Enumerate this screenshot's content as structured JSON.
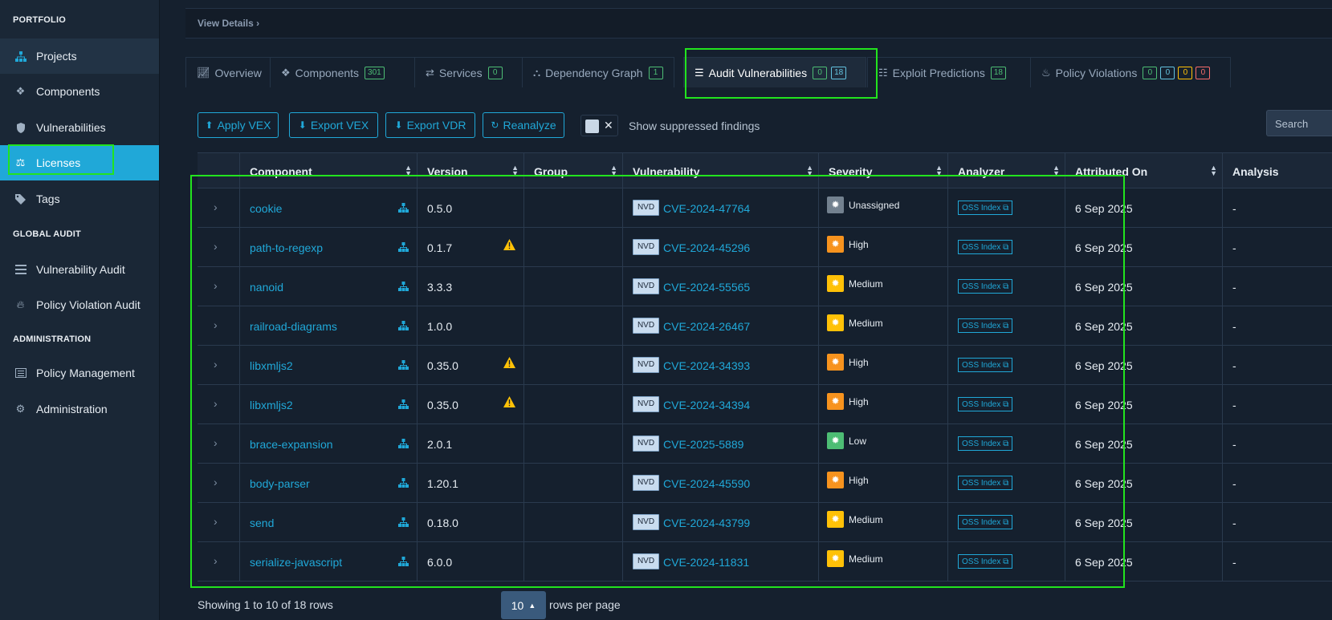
{
  "sidebar": {
    "sections": [
      {
        "label": "PORTFOLIO"
      },
      {
        "label": "GLOBAL AUDIT"
      },
      {
        "label": "ADMINISTRATION"
      }
    ],
    "items": [
      {
        "label": "Projects",
        "icon": "sitemap-icon"
      },
      {
        "label": "Components",
        "icon": "cubes-icon"
      },
      {
        "label": "Vulnerabilities",
        "icon": "shield-icon"
      },
      {
        "label": "Licenses",
        "icon": "balance-scale-icon",
        "active": true
      },
      {
        "label": "Tags",
        "icon": "tag-icon"
      },
      {
        "label": "Vulnerability Audit",
        "icon": "tasks-icon"
      },
      {
        "label": "Policy Violation Audit",
        "icon": "fire-icon"
      },
      {
        "label": "Policy Management",
        "icon": "list-alt-icon"
      },
      {
        "label": "Administration",
        "icon": "cogs-icon"
      }
    ]
  },
  "view_details": "View Details",
  "tabs": [
    {
      "label": "Overview",
      "badges": []
    },
    {
      "label": "Components",
      "badges": [
        "301"
      ]
    },
    {
      "label": "Services",
      "badges": [
        "0"
      ]
    },
    {
      "label": "Dependency Graph",
      "badges": [
        "1"
      ]
    },
    {
      "label": "Audit Vulnerabilities",
      "badges": [
        "0",
        "18"
      ],
      "active": true
    },
    {
      "label": "Exploit Predictions",
      "badges": [
        "18"
      ]
    },
    {
      "label": "Policy Violations",
      "badges": [
        "0",
        "0",
        "0",
        "0"
      ]
    }
  ],
  "toolbar": {
    "apply_vex": "Apply VEX",
    "export_vex": "Export VEX",
    "export_vdr": "Export VDR",
    "reanalyze": "Reanalyze",
    "show_suppressed": "Show suppressed findings",
    "search_placeholder": "Search"
  },
  "table": {
    "columns": [
      "",
      "Component",
      "Version",
      "Group",
      "Vulnerability",
      "Severity",
      "Analyzer",
      "Attributed On",
      "Analysis"
    ],
    "rows": [
      {
        "component": "cookie",
        "version": "0.5.0",
        "warn": false,
        "group": "",
        "source": "NVD",
        "vuln": "CVE-2024-47764",
        "severity": "Unassigned",
        "sev_color": "#73818f",
        "analyzer": "OSS Index",
        "attributed": "6 Sep 2025",
        "analysis": "-"
      },
      {
        "component": "path-to-regexp",
        "version": "0.1.7",
        "warn": true,
        "group": "",
        "source": "NVD",
        "vuln": "CVE-2024-45296",
        "severity": "High",
        "sev_color": "#f7931e",
        "analyzer": "OSS Index",
        "attributed": "6 Sep 2025",
        "analysis": "-"
      },
      {
        "component": "nanoid",
        "version": "3.3.3",
        "warn": false,
        "group": "",
        "source": "NVD",
        "vuln": "CVE-2024-55565",
        "severity": "Medium",
        "sev_color": "#ffc107",
        "analyzer": "OSS Index",
        "attributed": "6 Sep 2025",
        "analysis": "-"
      },
      {
        "component": "railroad-diagrams",
        "version": "1.0.0",
        "warn": false,
        "group": "",
        "source": "NVD",
        "vuln": "CVE-2024-26467",
        "severity": "Medium",
        "sev_color": "#ffc107",
        "analyzer": "OSS Index",
        "attributed": "6 Sep 2025",
        "analysis": "-"
      },
      {
        "component": "libxmljs2",
        "version": "0.35.0",
        "warn": true,
        "group": "",
        "source": "NVD",
        "vuln": "CVE-2024-34393",
        "severity": "High",
        "sev_color": "#f7931e",
        "analyzer": "OSS Index",
        "attributed": "6 Sep 2025",
        "analysis": "-"
      },
      {
        "component": "libxmljs2",
        "version": "0.35.0",
        "warn": true,
        "group": "",
        "source": "NVD",
        "vuln": "CVE-2024-34394",
        "severity": "High",
        "sev_color": "#f7931e",
        "analyzer": "OSS Index",
        "attributed": "6 Sep 2025",
        "analysis": "-"
      },
      {
        "component": "brace-expansion",
        "version": "2.0.1",
        "warn": false,
        "group": "",
        "source": "NVD",
        "vuln": "CVE-2025-5889",
        "severity": "Low",
        "sev_color": "#4dbd74",
        "analyzer": "OSS Index",
        "attributed": "6 Sep 2025",
        "analysis": "-"
      },
      {
        "component": "body-parser",
        "version": "1.20.1",
        "warn": false,
        "group": "",
        "source": "NVD",
        "vuln": "CVE-2024-45590",
        "severity": "High",
        "sev_color": "#f7931e",
        "analyzer": "OSS Index",
        "attributed": "6 Sep 2025",
        "analysis": "-"
      },
      {
        "component": "send",
        "version": "0.18.0",
        "warn": false,
        "group": "",
        "source": "NVD",
        "vuln": "CVE-2024-43799",
        "severity": "Medium",
        "sev_color": "#ffc107",
        "analyzer": "OSS Index",
        "attributed": "6 Sep 2025",
        "analysis": "-"
      },
      {
        "component": "serialize-javascript",
        "version": "6.0.0",
        "warn": false,
        "group": "",
        "source": "NVD",
        "vuln": "CVE-2024-11831",
        "severity": "Medium",
        "sev_color": "#ffc107",
        "analyzer": "OSS Index",
        "attributed": "6 Sep 2025",
        "analysis": "-"
      }
    ]
  },
  "pagination": {
    "showing": "Showing 1 to 10 of 18 rows",
    "page_size": "10",
    "rows_per_page": "rows per page"
  },
  "colors": {
    "accent": "#20a8d8",
    "highlight": "#22e41e"
  }
}
